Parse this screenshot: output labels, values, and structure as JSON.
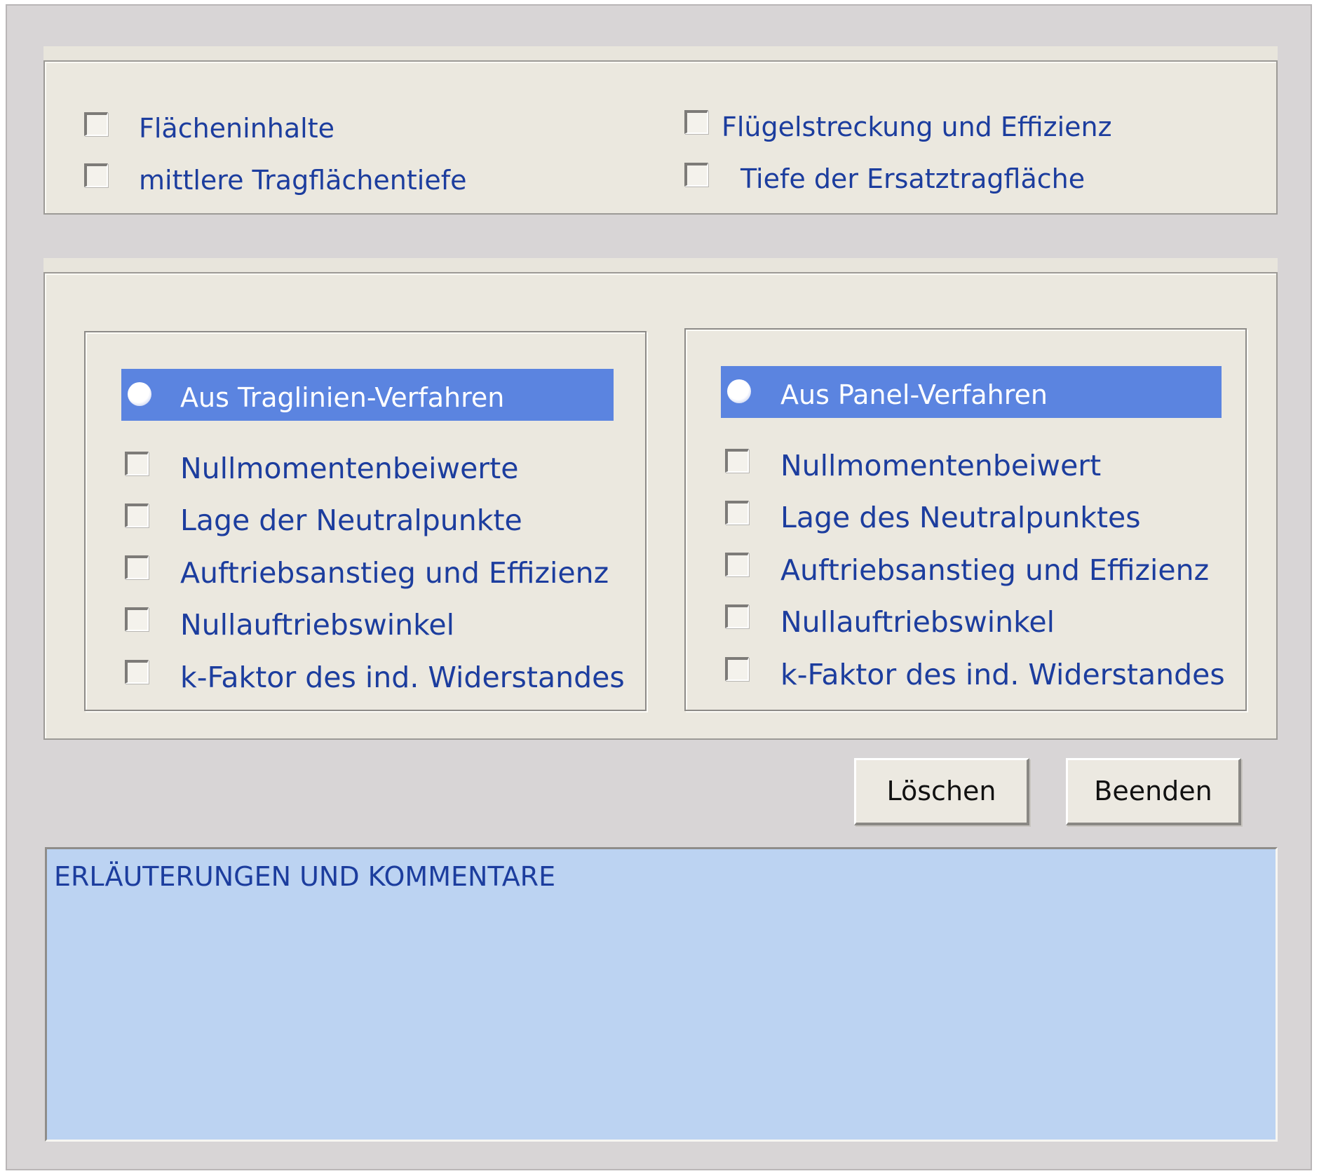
{
  "top_options": {
    "items": [
      {
        "label": "Flächeninhalte",
        "checked": false
      },
      {
        "label": "mittlere Tragflächentiefe",
        "checked": false
      },
      {
        "label": "Flügelstreckung und Effizienz",
        "checked": false
      },
      {
        "label": "Tiefe der Ersatztragfläche",
        "checked": false
      }
    ]
  },
  "left_group": {
    "radio_label": "Aus  Traglinien-Verfahren",
    "radio_selected": true,
    "items": [
      {
        "label": "Nullmomentenbeiwerte",
        "checked": false
      },
      {
        "label": "Lage der Neutralpunkte",
        "checked": false
      },
      {
        "label": "Auftriebsanstieg und Effizienz",
        "checked": false
      },
      {
        "label": "Nullauftriebswinkel",
        "checked": false
      },
      {
        "label": "k-Faktor des ind. Widerstandes",
        "checked": false
      }
    ]
  },
  "right_group": {
    "radio_label": "Aus Panel-Verfahren",
    "radio_selected": true,
    "items": [
      {
        "label": "Nullmomentenbeiwert",
        "checked": false
      },
      {
        "label": "Lage des Neutralpunktes",
        "checked": false
      },
      {
        "label": "Auftriebsanstieg und Effizienz",
        "checked": false
      },
      {
        "label": "Nullauftriebswinkel",
        "checked": false
      },
      {
        "label": "k-Faktor des ind. Widerstandes",
        "checked": false
      }
    ]
  },
  "buttons": {
    "clear_label": "Löschen",
    "exit_label": "Beenden"
  },
  "comments": {
    "title": "ERLÄUTERUNGEN UND KOMMENTARE",
    "value": ""
  },
  "colors": {
    "accent": "#5b84e0",
    "text": "#1c3d9e",
    "comments_bg": "#bcd3f2"
  }
}
